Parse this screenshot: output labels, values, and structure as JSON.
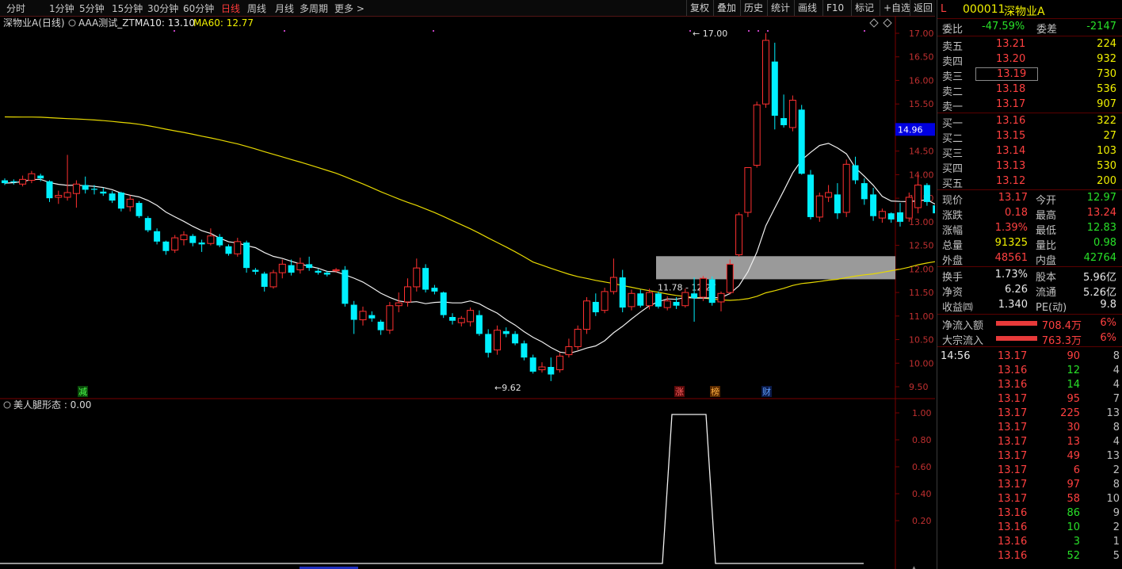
{
  "toolbar": {
    "periods": [
      "分时",
      "1分钟",
      "5分钟",
      "15分钟",
      "30分钟",
      "60分钟",
      "日线",
      "周线",
      "月线",
      "多周期",
      "更多 >"
    ],
    "active_period": "日线",
    "buttons": [
      "复权",
      "叠加",
      "历史",
      "统计",
      "画线",
      "F10",
      "标记",
      "+自选",
      "返回"
    ]
  },
  "chart_header": {
    "stock": "深物业A(日线)",
    "indicator": "AAA测试_ZT",
    "ma10": "MA10: 13.10",
    "ma60": "MA60: 12.77"
  },
  "indicator_header": "美人腿形态 : 0.00",
  "price_axis": [
    "17.00",
    "16.50",
    "16.00",
    "15.50",
    "15.00",
    "14.50",
    "14.00",
    "13.50",
    "13.00",
    "12.50",
    "12.00",
    "11.50",
    "11.00",
    "10.50",
    "10.00",
    "9.50"
  ],
  "current_price_tag": "14.96",
  "indicator_axis": [
    "1.00",
    "0.80",
    "0.60",
    "0.40",
    "0.20"
  ],
  "annotations": {
    "high": "17.00",
    "low": "9.62",
    "zone": "11.78 - 12.27",
    "markers": [
      "减",
      "涨",
      "榜",
      "财"
    ]
  },
  "chart_data": {
    "type": "candlestick",
    "ylim": [
      9.4,
      17.2
    ],
    "ohlc": [
      [
        13.88,
        13.92,
        13.78,
        13.82
      ],
      [
        13.86,
        13.9,
        13.79,
        13.84
      ],
      [
        13.8,
        13.98,
        13.75,
        13.9
      ],
      [
        13.88,
        14.08,
        13.82,
        14.02
      ],
      [
        13.98,
        14.02,
        13.86,
        13.92
      ],
      [
        13.86,
        13.88,
        13.42,
        13.5
      ],
      [
        13.52,
        13.66,
        13.38,
        13.56
      ],
      [
        13.52,
        14.42,
        13.45,
        13.62
      ],
      [
        13.6,
        13.88,
        13.3,
        13.8
      ],
      [
        13.78,
        13.96,
        13.6,
        13.68
      ],
      [
        13.7,
        13.78,
        13.58,
        13.68
      ],
      [
        13.64,
        13.72,
        13.55,
        13.6
      ],
      [
        13.6,
        13.65,
        13.4,
        13.45
      ],
      [
        13.62,
        13.64,
        13.22,
        13.28
      ],
      [
        13.32,
        13.56,
        13.22,
        13.48
      ],
      [
        13.4,
        13.44,
        13.08,
        13.12
      ],
      [
        13.08,
        13.12,
        12.78,
        12.82
      ],
      [
        12.8,
        12.86,
        12.52,
        12.58
      ],
      [
        12.58,
        12.6,
        12.3,
        12.38
      ],
      [
        12.4,
        12.72,
        12.34,
        12.66
      ],
      [
        12.62,
        12.8,
        12.5,
        12.72
      ],
      [
        12.7,
        12.74,
        12.48,
        12.55
      ],
      [
        12.56,
        12.62,
        12.36,
        12.52
      ],
      [
        12.54,
        12.86,
        12.5,
        12.7
      ],
      [
        12.68,
        12.74,
        12.46,
        12.5
      ],
      [
        12.48,
        12.52,
        12.28,
        12.32
      ],
      [
        12.32,
        12.66,
        12.26,
        12.58
      ],
      [
        12.56,
        12.6,
        11.92,
        12.02
      ],
      [
        11.98,
        12.02,
        11.88,
        11.94
      ],
      [
        11.9,
        11.94,
        11.52,
        11.62
      ],
      [
        11.62,
        11.98,
        11.58,
        11.92
      ],
      [
        11.92,
        12.2,
        11.8,
        12.1
      ],
      [
        12.08,
        12.2,
        11.86,
        11.92
      ],
      [
        11.98,
        12.24,
        11.9,
        12.12
      ],
      [
        12.1,
        12.26,
        11.96,
        12.02
      ],
      [
        11.96,
        12.0,
        11.88,
        11.92
      ],
      [
        11.92,
        11.96,
        11.84,
        11.88
      ],
      [
        11.96,
        12.02,
        11.92,
        11.98
      ],
      [
        11.98,
        12.06,
        11.2,
        11.26
      ],
      [
        11.24,
        11.32,
        10.62,
        10.92
      ],
      [
        10.92,
        11.2,
        10.8,
        11.1
      ],
      [
        11.02,
        11.1,
        10.88,
        10.95
      ],
      [
        10.88,
        10.92,
        10.6,
        10.7
      ],
      [
        10.7,
        11.3,
        10.62,
        11.22
      ],
      [
        11.22,
        11.5,
        11.08,
        11.28
      ],
      [
        11.3,
        11.8,
        11.2,
        11.62
      ],
      [
        11.62,
        12.22,
        11.52,
        12.02
      ],
      [
        12.02,
        12.1,
        11.5,
        11.56
      ],
      [
        11.6,
        11.66,
        11.46,
        11.52
      ],
      [
        11.5,
        11.52,
        10.96,
        11.02
      ],
      [
        10.98,
        11.06,
        10.82,
        10.9
      ],
      [
        10.86,
        11.0,
        10.78,
        10.95
      ],
      [
        10.88,
        11.18,
        10.78,
        11.12
      ],
      [
        11.02,
        11.12,
        10.58,
        10.62
      ],
      [
        10.62,
        10.72,
        10.12,
        10.22
      ],
      [
        10.28,
        10.8,
        10.18,
        10.7
      ],
      [
        10.68,
        10.76,
        10.55,
        10.62
      ],
      [
        10.62,
        10.68,
        10.38,
        10.42
      ],
      [
        10.42,
        10.48,
        10.06,
        10.12
      ],
      [
        10.12,
        10.18,
        9.78,
        9.82
      ],
      [
        9.86,
        10.02,
        9.8,
        9.92
      ],
      [
        9.92,
        10.12,
        9.62,
        9.76
      ],
      [
        9.86,
        10.22,
        9.8,
        10.15
      ],
      [
        10.18,
        10.52,
        10.12,
        10.35
      ],
      [
        10.35,
        10.8,
        10.28,
        10.72
      ],
      [
        10.72,
        11.4,
        10.62,
        11.32
      ],
      [
        11.3,
        11.48,
        11.0,
        11.08
      ],
      [
        11.12,
        11.6,
        11.06,
        11.52
      ],
      [
        11.52,
        12.22,
        11.46,
        11.82
      ],
      [
        11.82,
        11.98,
        11.08,
        11.18
      ],
      [
        11.2,
        11.56,
        11.12,
        11.48
      ],
      [
        11.48,
        11.56,
        11.18,
        11.22
      ],
      [
        11.22,
        11.58,
        11.14,
        11.5
      ],
      [
        11.48,
        11.52,
        11.16,
        11.2
      ],
      [
        11.18,
        11.42,
        11.12,
        11.32
      ],
      [
        11.3,
        11.4,
        11.15,
        11.22
      ],
      [
        11.22,
        11.58,
        11.18,
        11.5
      ],
      [
        11.48,
        11.82,
        10.88,
        11.38
      ],
      [
        11.4,
        11.85,
        11.32,
        11.8
      ],
      [
        11.78,
        11.84,
        11.22,
        11.28
      ],
      [
        11.3,
        11.52,
        11.1,
        11.48
      ],
      [
        11.5,
        12.2,
        11.46,
        12.1
      ],
      [
        12.3,
        13.2,
        12.26,
        13.15
      ],
      [
        13.2,
        14.15,
        13.1,
        14.15
      ],
      [
        14.2,
        15.55,
        14.15,
        15.48
      ],
      [
        15.5,
        17.0,
        15.42,
        16.85
      ],
      [
        16.4,
        16.8,
        14.96,
        15.25
      ],
      [
        15.2,
        15.7,
        15.0,
        15.05
      ],
      [
        15.0,
        15.68,
        14.92,
        15.58
      ],
      [
        15.38,
        15.48,
        14.0,
        14.02
      ],
      [
        14.0,
        14.1,
        13.05,
        13.1
      ],
      [
        13.1,
        13.62,
        13.0,
        13.55
      ],
      [
        13.52,
        13.78,
        13.42,
        13.62
      ],
      [
        13.58,
        13.82,
        13.06,
        13.18
      ],
      [
        13.2,
        14.32,
        13.1,
        14.22
      ],
      [
        14.2,
        14.38,
        13.8,
        13.88
      ],
      [
        13.82,
        13.92,
        13.36,
        13.48
      ],
      [
        13.58,
        13.72,
        13.02,
        13.12
      ],
      [
        13.08,
        13.28,
        12.98,
        13.22
      ],
      [
        13.18,
        13.2,
        12.98,
        13.05
      ],
      [
        13.2,
        13.4,
        12.9,
        13.0
      ],
      [
        13.08,
        13.62,
        13.0,
        13.52
      ],
      [
        13.3,
        14.02,
        13.18,
        13.78
      ],
      [
        13.78,
        13.82,
        13.34,
        13.42
      ],
      [
        13.35,
        13.4,
        13.12,
        13.18
      ],
      [
        13.12,
        13.16,
        12.62,
        12.7
      ],
      [
        12.66,
        12.7,
        12.36,
        12.48
      ],
      [
        12.46,
        12.94,
        12.35,
        12.88
      ],
      [
        12.88,
        13.05,
        12.82,
        13.02
      ],
      [
        13.0,
        13.1,
        12.8,
        13.1
      ],
      [
        12.97,
        13.24,
        12.83,
        13.17
      ]
    ]
  },
  "quote": {
    "stock_code": "000011",
    "stock_name": "深物业A",
    "prefix": "L",
    "weibi_label": "委比",
    "weibi": "-47.59%",
    "weicha_label": "委差",
    "weicha": "-2147",
    "sells": [
      {
        "label": "卖五",
        "price": "13.21",
        "vol": "224"
      },
      {
        "label": "卖四",
        "price": "13.20",
        "vol": "932"
      },
      {
        "label": "卖三",
        "price": "13.19",
        "vol": "730"
      },
      {
        "label": "卖二",
        "price": "13.18",
        "vol": "536"
      },
      {
        "label": "卖一",
        "price": "13.17",
        "vol": "907"
      }
    ],
    "buys": [
      {
        "label": "买一",
        "price": "13.16",
        "vol": "322"
      },
      {
        "label": "买二",
        "price": "13.15",
        "vol": "27"
      },
      {
        "label": "买三",
        "price": "13.14",
        "vol": "103"
      },
      {
        "label": "买四",
        "price": "13.13",
        "vol": "530"
      },
      {
        "label": "买五",
        "price": "13.12",
        "vol": "200"
      }
    ],
    "stats": [
      {
        "l1": "现价",
        "v1": "13.17",
        "c1": "red",
        "l2": "今开",
        "v2": "12.97",
        "c2": "green"
      },
      {
        "l1": "涨跌",
        "v1": "0.18",
        "c1": "red",
        "l2": "最高",
        "v2": "13.24",
        "c2": "red"
      },
      {
        "l1": "涨幅",
        "v1": "1.39%",
        "c1": "red",
        "l2": "最低",
        "v2": "12.83",
        "c2": "green"
      },
      {
        "l1": "总量",
        "v1": "91325",
        "c1": "yellow",
        "l2": "量比",
        "v2": "0.98",
        "c2": "green"
      },
      {
        "l1": "外盘",
        "v1": "48561",
        "c1": "red",
        "l2": "内盘",
        "v2": "42764",
        "c2": "green"
      }
    ],
    "finance": [
      {
        "l1": "换手",
        "v1": "1.73%",
        "l2": "股本",
        "v2": "5.96亿"
      },
      {
        "l1": "净资",
        "v1": "6.26",
        "l2": "流通",
        "v2": "5.26亿"
      },
      {
        "l1": "收益㈣",
        "v1": "1.340",
        "l2": "PE(动)",
        "v2": "9.8"
      }
    ],
    "flows": [
      {
        "label": "净流入额",
        "value": "708.4万",
        "pct": "6%"
      },
      {
        "label": "大宗流入",
        "value": "763.3万",
        "pct": "6%"
      }
    ],
    "ticks": [
      {
        "time": "14:56",
        "price": "13.17",
        "vol": "90",
        "n": "8",
        "pc": "red",
        "vc": "red"
      },
      {
        "time": "",
        "price": "13.16",
        "vol": "12",
        "n": "4",
        "pc": "red",
        "vc": "green"
      },
      {
        "time": "",
        "price": "13.16",
        "vol": "14",
        "n": "4",
        "pc": "red",
        "vc": "green"
      },
      {
        "time": "",
        "price": "13.17",
        "vol": "95",
        "n": "7",
        "pc": "red",
        "vc": "red"
      },
      {
        "time": "",
        "price": "13.17",
        "vol": "225",
        "n": "13",
        "pc": "red",
        "vc": "red"
      },
      {
        "time": "",
        "price": "13.17",
        "vol": "30",
        "n": "8",
        "pc": "red",
        "vc": "red"
      },
      {
        "time": "",
        "price": "13.17",
        "vol": "13",
        "n": "4",
        "pc": "red",
        "vc": "red"
      },
      {
        "time": "",
        "price": "13.17",
        "vol": "49",
        "n": "13",
        "pc": "red",
        "vc": "red"
      },
      {
        "time": "",
        "price": "13.17",
        "vol": "6",
        "n": "2",
        "pc": "red",
        "vc": "red"
      },
      {
        "time": "",
        "price": "13.17",
        "vol": "97",
        "n": "8",
        "pc": "red",
        "vc": "red"
      },
      {
        "time": "",
        "price": "13.17",
        "vol": "58",
        "n": "10",
        "pc": "red",
        "vc": "red"
      },
      {
        "time": "",
        "price": "13.16",
        "vol": "86",
        "n": "9",
        "pc": "red",
        "vc": "green"
      },
      {
        "time": "",
        "price": "13.16",
        "vol": "10",
        "n": "2",
        "pc": "red",
        "vc": "green"
      },
      {
        "time": "",
        "price": "13.16",
        "vol": "3",
        "n": "1",
        "pc": "red",
        "vc": "green"
      },
      {
        "time": "",
        "price": "13.16",
        "vol": "52",
        "n": "5",
        "pc": "red",
        "vc": "green"
      }
    ]
  }
}
